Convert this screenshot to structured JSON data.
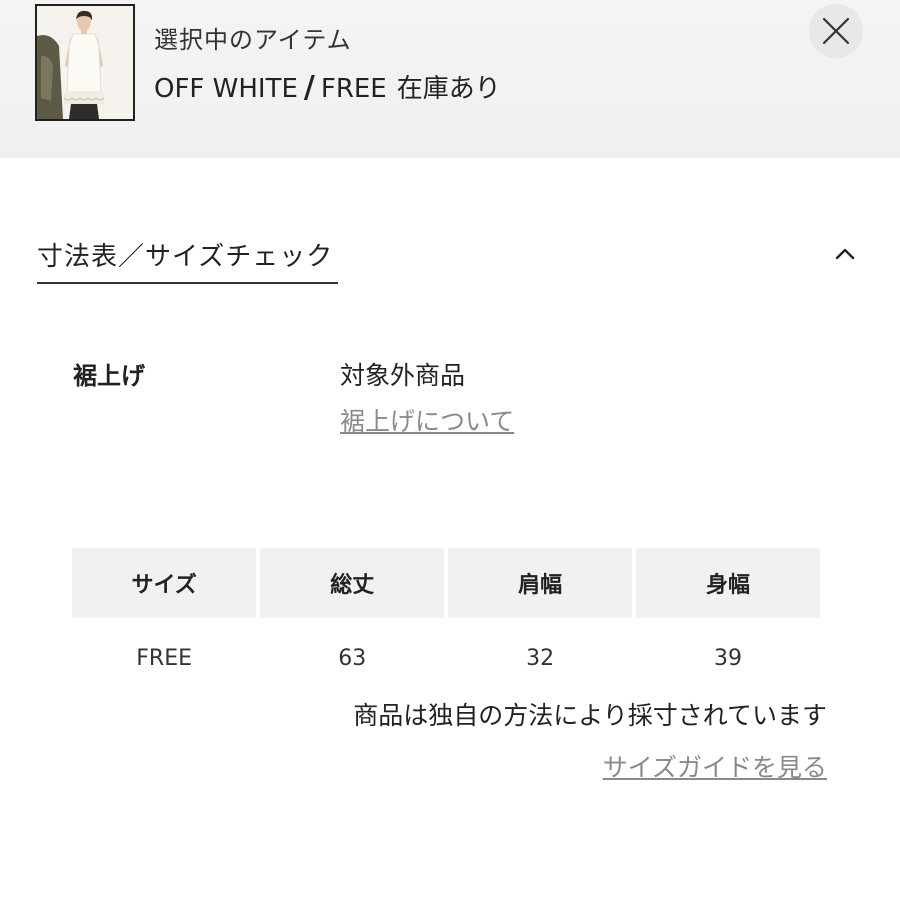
{
  "selected_item": {
    "caption": "選択中のアイテム",
    "color": "OFF WHITE",
    "separator": "/",
    "size": "FREE",
    "stock": "在庫あり"
  },
  "close_icon": "close-icon",
  "section": {
    "title": "寸法表／サイズチェック",
    "toggle_icon": "chevron-up-icon"
  },
  "hem": {
    "label": "裾上げ",
    "value": "対象外商品",
    "link": "裾上げについて"
  },
  "size_table": {
    "headers": [
      "サイズ",
      "総丈",
      "肩幅",
      "身幅"
    ],
    "rows": [
      [
        "FREE",
        "63",
        "32",
        "39"
      ]
    ]
  },
  "note": "商品は独自の方法により採寸されています",
  "guide_link": "サイズガイドを見る",
  "colors": {
    "header_bg": "#f0f0f0",
    "table_header_bg": "#f1f1f1",
    "link": "#8a8a8a"
  }
}
